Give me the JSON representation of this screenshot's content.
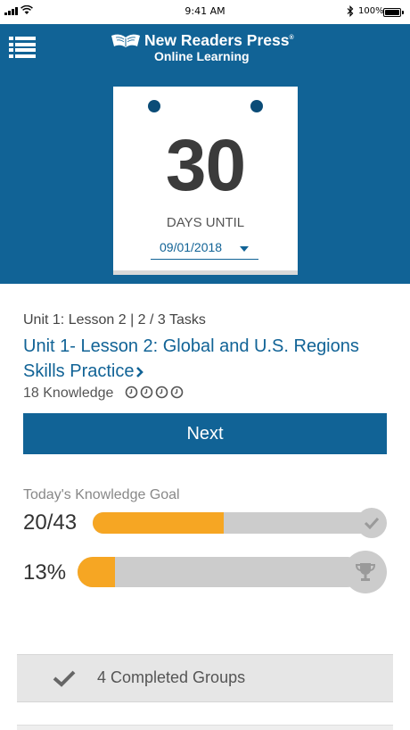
{
  "status_bar": {
    "time": "9:41 AM",
    "battery_percent": "100%",
    "icons": [
      "signal-icon",
      "wifi-icon",
      "bluetooth-icon",
      "battery-icon"
    ]
  },
  "header": {
    "brand_name": "New Readers Press",
    "brand_tm": "®",
    "brand_subtitle": "Online Learning",
    "background_color": "#116396",
    "menu_icon": "menu-list-icon"
  },
  "countdown": {
    "days": "30",
    "label": "DAYS UNTIL",
    "date": "09/01/2018"
  },
  "lesson": {
    "meta": "Unit 1: Lesson 2 | 2 / 3 Tasks",
    "title_line1": "Unit 1- Lesson 2: Global and U.S. Regions",
    "title_line2": "Skills Practice",
    "knowledge": "18 Knowledge",
    "knowledge_icon_count": 4,
    "next_label": "Next"
  },
  "goals": {
    "heading": "Today's Knowledge Goal",
    "knowledge_value": "20/43",
    "knowledge_progress": 0.465,
    "percent_value": "13%",
    "percent_progress": 0.13,
    "fill_color": "#f6a623"
  },
  "completed": {
    "label": "4 Completed Groups"
  }
}
